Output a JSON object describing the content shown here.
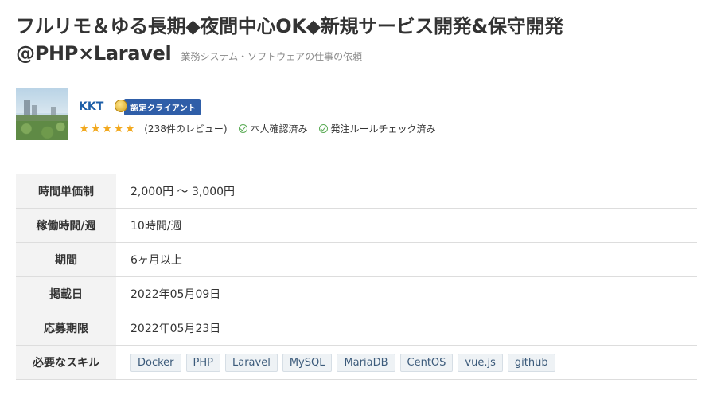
{
  "job": {
    "title_line1": "フルリモ＆ゆる長期◆夜間中心OK◆新規サービス開発&保守開発",
    "title_line2": "@PHP×Laravel",
    "category": "業務システム・ソフトウェアの仕事の依頼"
  },
  "client": {
    "name": "KKT",
    "badge_label": "認定クライアント",
    "rating": 5,
    "stars": "★★★★★",
    "reviews": "(238件のレビュー)",
    "checks": [
      "本人確認済み",
      "発注ルールチェック済み"
    ]
  },
  "details": [
    {
      "label": "時間単価制",
      "value": "2,000円 〜 3,000円"
    },
    {
      "label": "稼働時間/週",
      "value": "10時間/週"
    },
    {
      "label": "期間",
      "value": "6ヶ月以上"
    },
    {
      "label": "掲載日",
      "value": "2022年05月09日"
    },
    {
      "label": "応募期限",
      "value": "2022年05月23日"
    }
  ],
  "skills_label": "必要なスキル",
  "skills": [
    "Docker",
    "PHP",
    "Laravel",
    "MySQL",
    "MariaDB",
    "CentOS",
    "vue.js",
    "github"
  ],
  "colors": {
    "link": "#1d5fa8",
    "badge": "#2f5ea8",
    "star": "#f2a81d",
    "check": "#5aab55"
  }
}
